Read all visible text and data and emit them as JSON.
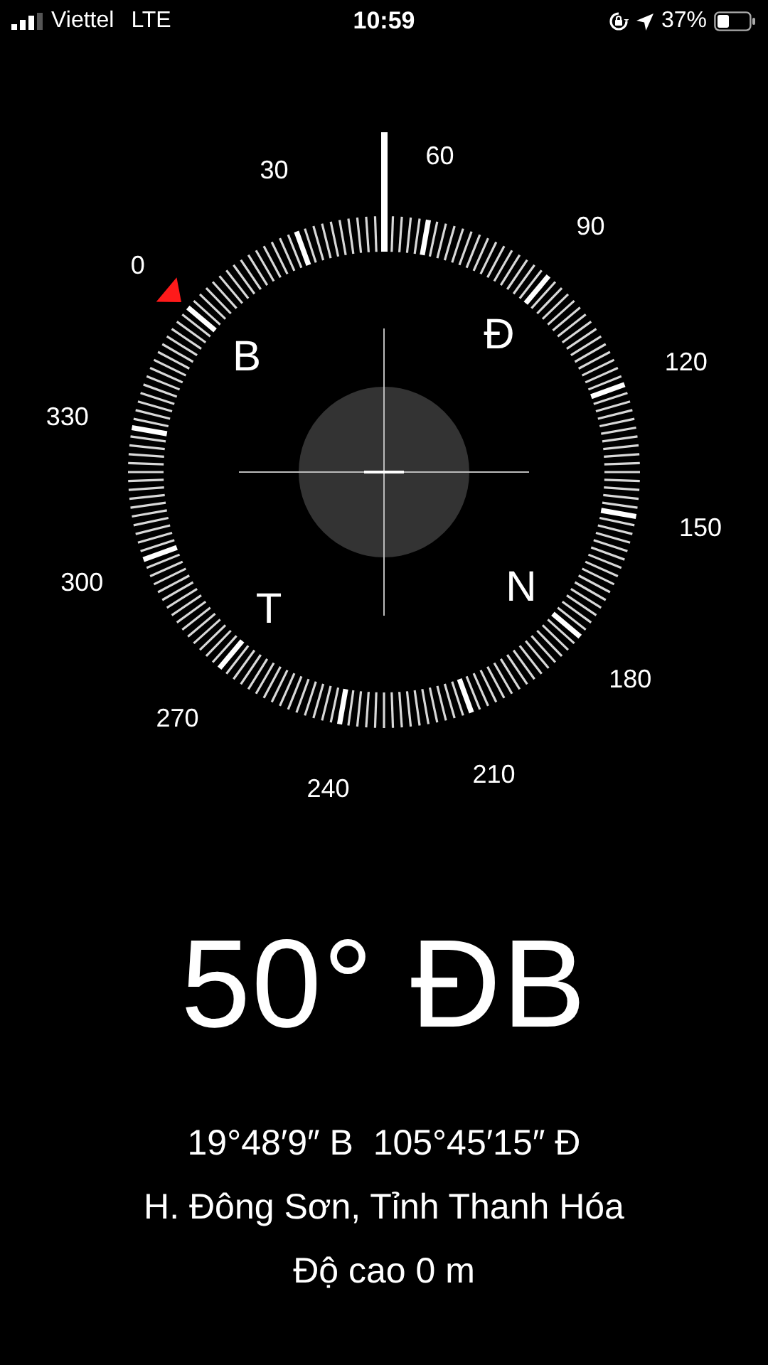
{
  "status_bar": {
    "carrier": "Viettel",
    "network": "LTE",
    "time": "10:59",
    "battery_percent": "37%"
  },
  "compass": {
    "degree_labels": [
      "0",
      "30",
      "60",
      "90",
      "120",
      "150",
      "180",
      "210",
      "240",
      "270",
      "300",
      "330"
    ],
    "cardinals": [
      "B",
      "Đ",
      "T",
      "N"
    ]
  },
  "heading": "50° ĐB",
  "coordinates": "19°48′9″ B  105°45′15″ Đ",
  "location": "H. Đông Sơn, Tỉnh Thanh Hóa",
  "altitude": "Độ cao 0 m"
}
